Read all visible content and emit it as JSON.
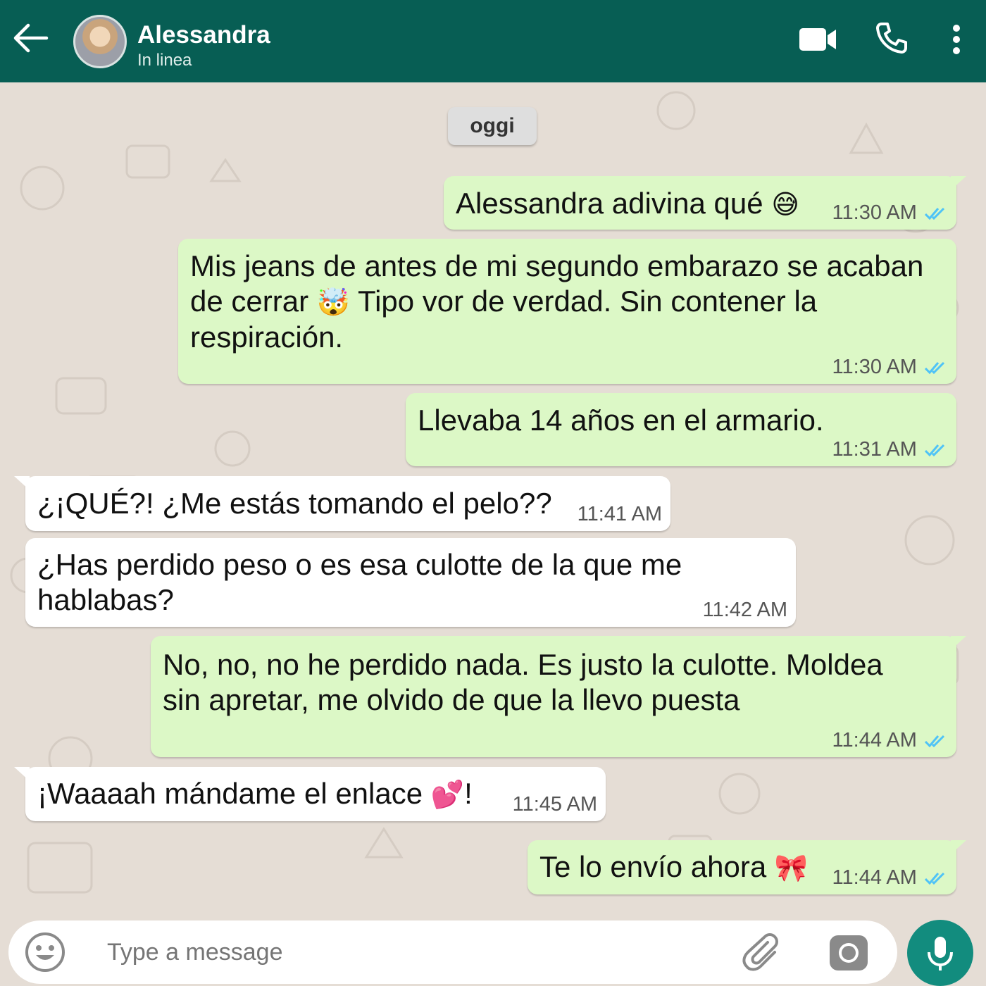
{
  "header": {
    "contact_name": "Alessandra",
    "status": "In linea",
    "back_icon": "arrow-left-icon",
    "video_icon": "video-camera-icon",
    "call_icon": "phone-icon",
    "menu_icon": "more-vertical-icon",
    "background": "#075e54"
  },
  "chat": {
    "date_label": "oggi",
    "outgoing_color": "#dcf8c6",
    "incoming_color": "#ffffff",
    "read_tick_color": "#4fc3f7",
    "messages": [
      {
        "direction": "out",
        "lines": [
          "Alessandra adivina qué"
        ],
        "emoji": "😅",
        "time": "11:30 AM",
        "status": "read"
      },
      {
        "direction": "out",
        "lines": [
          "Mis jeans de antes de mi segundo embarazo se acaban",
          "de cerrar",
          " Tipo vor de verdad. Sin contener la",
          "respiración."
        ],
        "emoji": "🤯",
        "time": "11:30 AM",
        "status": "read"
      },
      {
        "direction": "out",
        "lines": [
          "Llevaba 14 años en el armario."
        ],
        "time": "11:31 AM",
        "status": "read"
      },
      {
        "direction": "in",
        "lines": [
          "¿¡QUÉ?! ¿Me estás tomando el pelo??"
        ],
        "time": "11:41 AM"
      },
      {
        "direction": "in",
        "lines": [
          "¿Has perdido peso o es esa culotte de la que me",
          "hablabas?"
        ],
        "time": "11:42 AM"
      },
      {
        "direction": "out",
        "lines": [
          "No, no, no he perdido nada. Es justo la culotte. Moldea",
          "sin apretar, me olvido de que la llevo puesta"
        ],
        "time": "11:44 AM",
        "status": "read"
      },
      {
        "direction": "in",
        "lines": [
          "¡Waaaah mándame el enlace",
          "!"
        ],
        "emoji": "💕",
        "time": "11:45 AM"
      },
      {
        "direction": "out",
        "lines": [
          "Te lo envío ahora"
        ],
        "emoji": "🎀",
        "time": "11:44 AM",
        "status": "read"
      }
    ]
  },
  "composer": {
    "placeholder": "Type a message",
    "emoji_icon": "smiley-icon",
    "attach_icon": "paperclip-icon",
    "camera_icon": "camera-icon",
    "mic_icon": "microphone-icon",
    "mic_button_color": "#128c7e"
  }
}
